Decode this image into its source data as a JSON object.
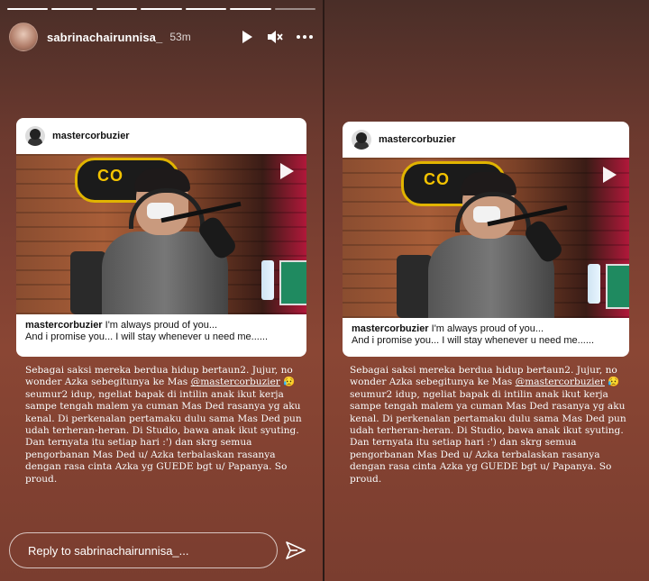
{
  "header": {
    "username": "sabrinachairunnisa_",
    "time": "53m"
  },
  "post": {
    "username": "mastercorbuzier",
    "media": {
      "sign_text": "CO",
      "sign_banner": "#CLOSETHEDOOR"
    },
    "caption_user": "mastercorbuzier",
    "caption_line1": " I'm always proud of you...",
    "caption_line2": "And i promise you... I will stay whenever u need me......"
  },
  "story": {
    "text_before": "Sebagai saksi mereka berdua hidup bertaun2. Jujur, no wonder Azka sebegitunya ke Mas ",
    "mention": "@mastercorbuzier",
    "emoji": "😥",
    "text_after": "\nseumur2 idup, ngeliat bapak di intilin anak ikut kerja sampe tengah malem ya cuman Mas Ded rasanya yg aku kenal. Di perkenalan pertamaku dulu sama Mas Ded pun udah terheran-heran. Di Studio, bawa anak ikut syuting. Dan ternyata itu setiap hari :') dan skrg semua pengorbanan Mas Ded u/ Azka terbalaskan rasanya dengan rasa cinta Azka yg GUEDE bgt u/ Papanya. So proud."
  },
  "reply": {
    "placeholder": "Reply to sabrinachairunnisa_..."
  },
  "progress": {
    "segments": 7,
    "completed": 6
  },
  "colors": {
    "background": "#7a3d2f",
    "sign_yellow": "#f3c300"
  },
  "icons": [
    "play-icon",
    "mute-icon",
    "more-icon",
    "send-icon",
    "video-play-icon"
  ]
}
